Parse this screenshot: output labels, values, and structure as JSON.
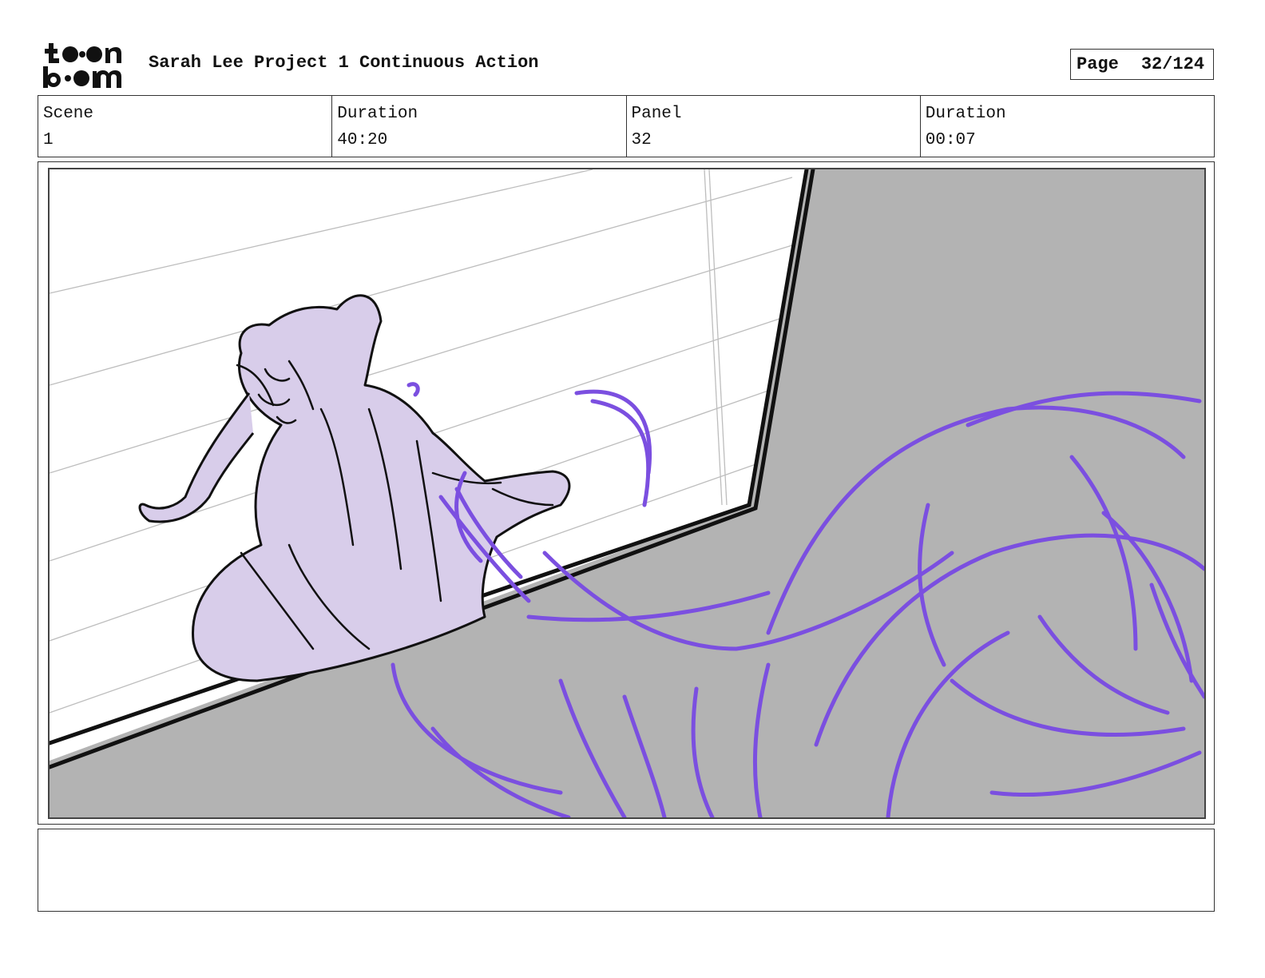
{
  "header": {
    "logo": {
      "line1": "toon",
      "line2": "boom"
    },
    "title": "Sarah Lee Project 1 Continuous Action",
    "page_label": "Page",
    "page_value": "32/124"
  },
  "info": {
    "scene_label": "Scene",
    "scene_value": "1",
    "duration_label": "Duration",
    "duration_value": "40:20",
    "panel_label": "Panel",
    "panel_value": "32",
    "panel_duration_label": "Duration",
    "panel_duration_value": "00:07"
  },
  "colors": {
    "figure_fill": "#d8cdea",
    "purple_lines": "#7b4fe0",
    "wall_gray": "#b3b3b3",
    "ink": "#111111"
  },
  "notes": {
    "text": ""
  }
}
